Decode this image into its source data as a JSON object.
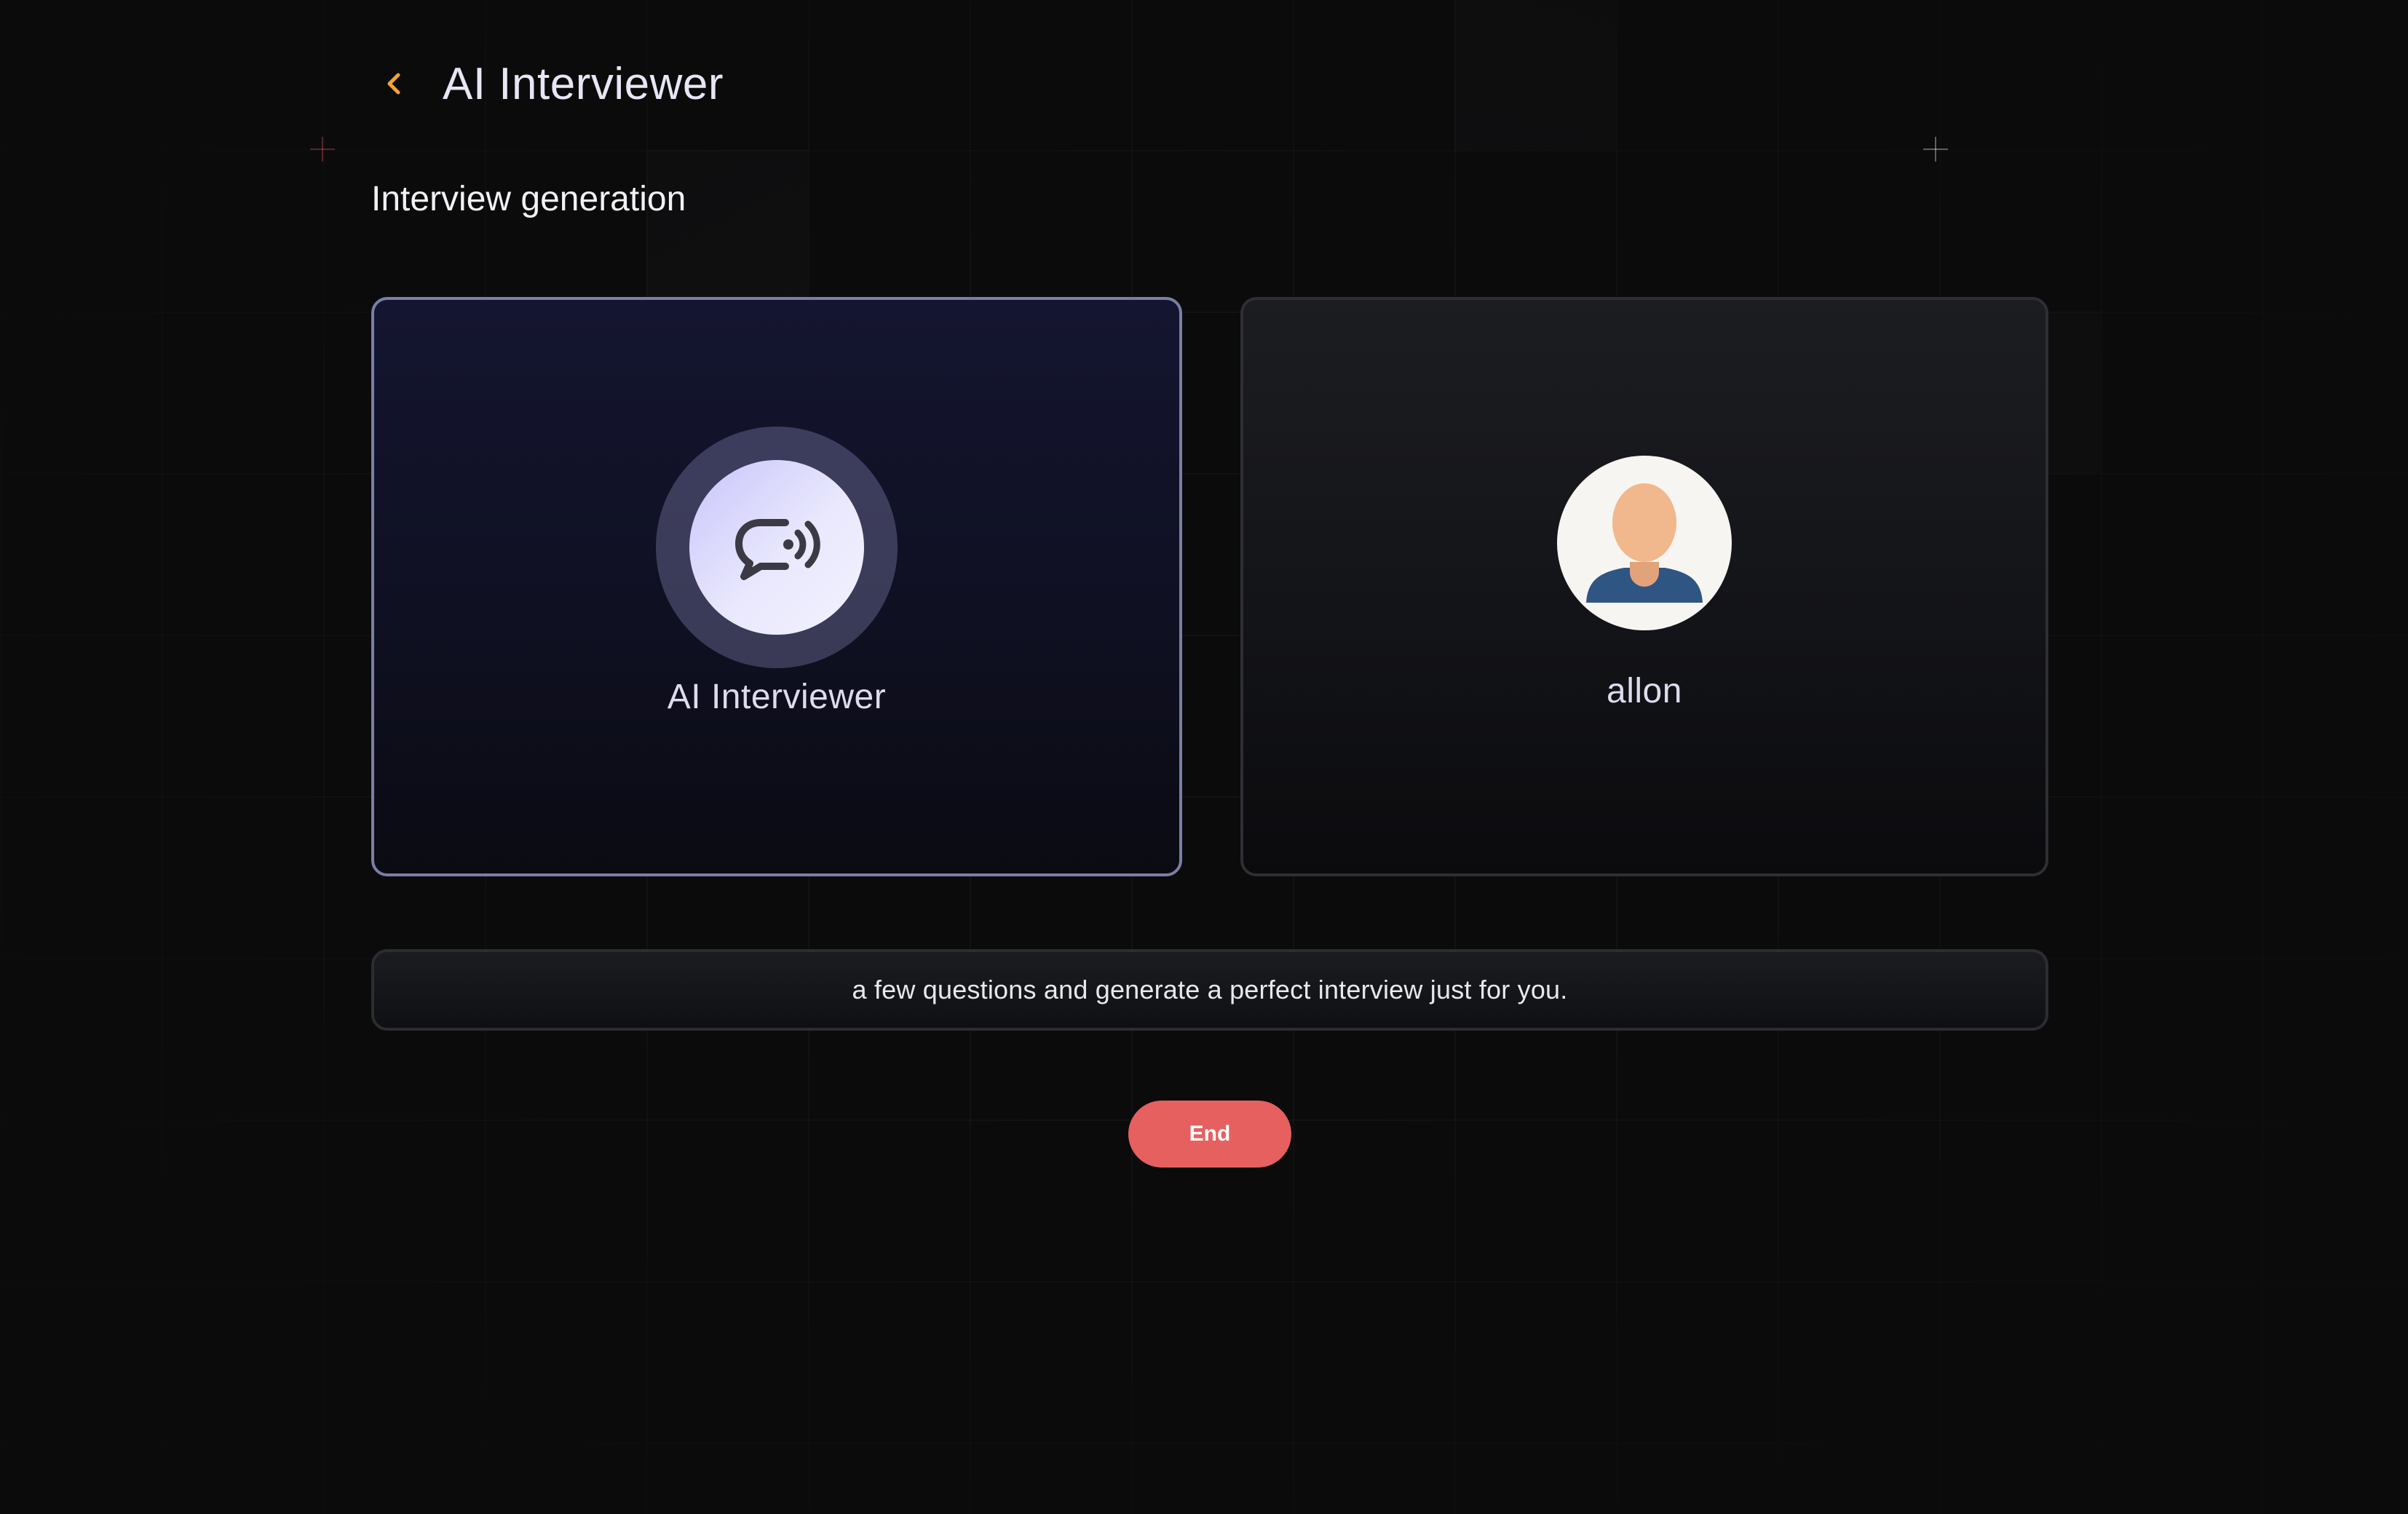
{
  "header": {
    "title": "AI Interviewer",
    "back_icon": "chevron-left-icon",
    "back_color": "#f0a23c"
  },
  "section": {
    "title": "Interview generation"
  },
  "interviewer_card": {
    "name": "AI Interviewer",
    "icon": "voice-chat-icon",
    "border_color": "#7b7fa6"
  },
  "user_card": {
    "name": "allon",
    "icon": "user-avatar-icon"
  },
  "transcript": {
    "text": "a few questions and generate a perfect interview just for you."
  },
  "controls": {
    "end_label": "End",
    "end_color": "#e6605f"
  }
}
